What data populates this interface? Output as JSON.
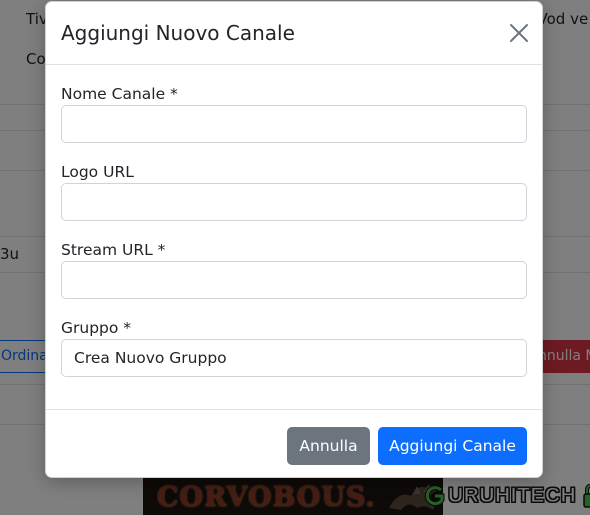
{
  "background": {
    "top_left_fragment": "Tiv",
    "top_right_fragment": "nVod ve",
    "second_line_fragment": "Co",
    "row_fragment": "3u",
    "left_button_fragment": "Ordina",
    "right_button_fragment": "nnulla M",
    "banner_text": "CORVOBOUS.",
    "watermark_text": "URUHITECH"
  },
  "modal": {
    "title": "Aggiungi Nuovo Canale",
    "fields": [
      {
        "label": "Nome Canale *",
        "value": "",
        "placeholder": ""
      },
      {
        "label": "Logo URL",
        "value": "",
        "placeholder": ""
      },
      {
        "label": "Stream URL *",
        "value": "",
        "placeholder": ""
      }
    ],
    "group": {
      "label": "Gruppo *",
      "selected": "Crea Nuovo Gruppo"
    },
    "buttons": {
      "cancel": "Annulla",
      "submit": "Aggiungi Canale"
    }
  },
  "colors": {
    "primary": "#0d6efd",
    "secondary": "#6c757d",
    "danger": "#dc3545",
    "backdrop": "rgba(0,0,0,0.5)"
  },
  "icons": {
    "close": "close-icon",
    "group_dropdown": "none"
  }
}
